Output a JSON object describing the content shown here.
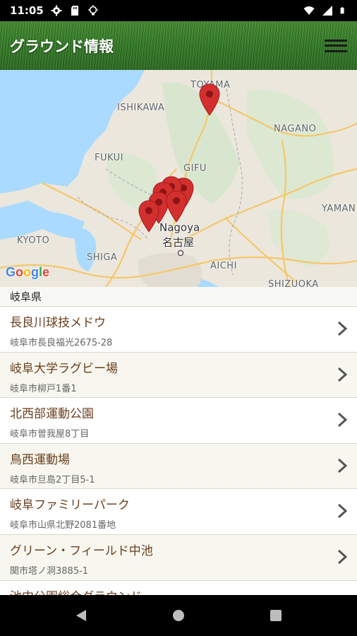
{
  "status_bar": {
    "time": "11:05",
    "icons": [
      "settings-icon",
      "sd-card-icon",
      "bulb-icon",
      "wifi-icon",
      "signal-icon",
      "battery-icon"
    ]
  },
  "app_bar": {
    "title": "グラウンド情報",
    "menu_icon": "hamburger-menu-icon"
  },
  "map": {
    "regions": [
      "ISHIKAWA",
      "FUKUI",
      "GIFU",
      "NAGANO",
      "TOYAMA",
      "KYOTO",
      "SHIGA",
      "AICHI",
      "SHIZUOKA",
      "YAMANASHI"
    ],
    "region_labels": {
      "toyama": "TOYAMA",
      "ishikawa": "ISHIKAWA",
      "nagano": "NAGANO",
      "fukui": "FUKUI",
      "gifu": "GIFU",
      "yamanashi": "YAMAN",
      "kyoto": "KYOTO",
      "shiga": "SHIGA",
      "aichi": "AICHI",
      "shizuoka": "SHIZUOKA"
    },
    "city_en": "Nagoya",
    "city_ja": "名古屋",
    "logo": "Google",
    "marker_color": "#d32f2f"
  },
  "list": {
    "section_title": "岐阜県",
    "items": [
      {
        "name": "長良川球技メドウ",
        "address": "岐阜市長良福光2675-28"
      },
      {
        "name": "岐阜大学ラグビー場",
        "address": "岐阜市柳戸1番1"
      },
      {
        "name": "北西部運動公園",
        "address": "岐阜市曽我屋8丁目"
      },
      {
        "name": "鳥西運動場",
        "address": "岐阜市旦島2丁目5-1"
      },
      {
        "name": "岐阜ファミリーパーク",
        "address": "岐阜市山県北野2081番地"
      },
      {
        "name": "グリーン・フィールド中池",
        "address": "関市塔ノ洞3885-1"
      },
      {
        "name": "池中公園総合グラウンド",
        "address": ""
      }
    ]
  },
  "nav_bar": {
    "buttons": [
      "back-icon",
      "home-icon",
      "recents-icon"
    ]
  }
}
